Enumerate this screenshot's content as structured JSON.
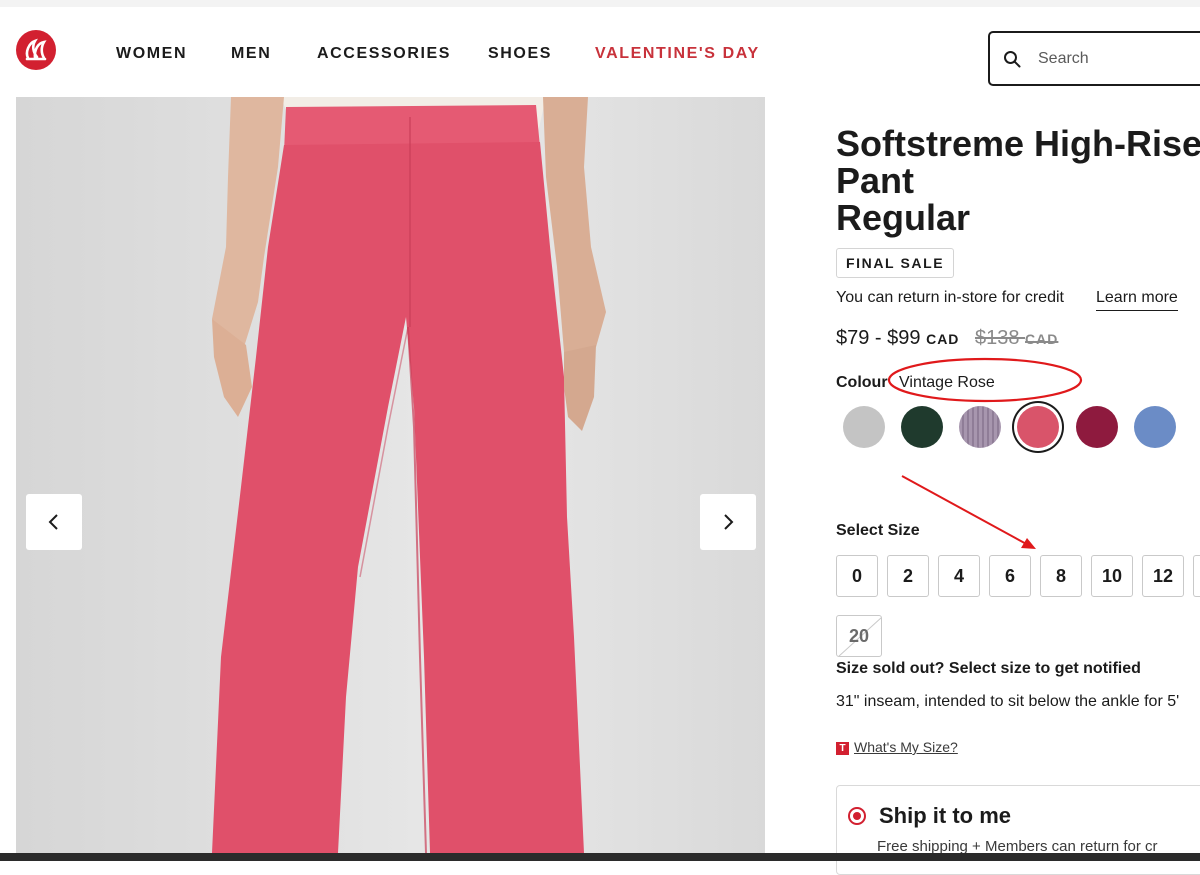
{
  "header": {
    "nav": [
      "WOMEN",
      "MEN",
      "ACCESSORIES",
      "SHOES",
      "VALENTINE'S DAY"
    ],
    "search_placeholder": "Search"
  },
  "product": {
    "title_lines": [
      "Softstreme High-Rise",
      "Pant",
      "Regular"
    ],
    "badge": "FINAL SALE",
    "return_text": "You can return in-store for credit",
    "learn_more": "Learn more",
    "price": {
      "range": "$79 - $99",
      "currency": "CAD",
      "original": "$138",
      "original_currency": "CAD"
    },
    "colour_label": "Colour",
    "colour_value": "Vintage Rose",
    "swatches": [
      {
        "name": "grey",
        "color": "#c4c4c4"
      },
      {
        "name": "dark-green",
        "color": "#1f3a2d"
      },
      {
        "name": "lavender-stripe",
        "color": "#a796ae"
      },
      {
        "name": "vintage-rose",
        "color": "#d9546a",
        "selected": true
      },
      {
        "name": "burgundy",
        "color": "#8e1a3e"
      },
      {
        "name": "blue",
        "color": "#6b8cc6"
      }
    ],
    "select_size_label": "Select Size",
    "sizes": [
      "0",
      "2",
      "4",
      "6",
      "8",
      "10",
      "12"
    ],
    "sold_out_sizes": [
      "20"
    ],
    "sold_out_note": "Size sold out? Select size to get notified",
    "inseam": "31\" inseam, intended to sit below the ankle for 5'",
    "whats_my_size": "What's My Size?",
    "whats_my_size_icon": "T",
    "ship_title": "Ship it to me",
    "ship_sub": "Free shipping + Members can return for cr"
  },
  "colors": {
    "brand_red": "#d22030",
    "nav_red": "#c8323b",
    "annotation_red": "#e0191b",
    "pant_pink": "#e0506a"
  }
}
